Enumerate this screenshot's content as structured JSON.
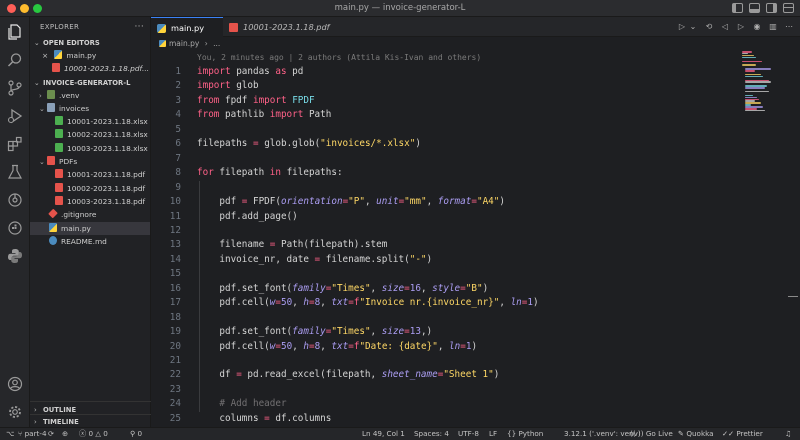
{
  "window": {
    "title": "main.py — invoice-generator-L"
  },
  "colors": {
    "accent": "#3b82f6",
    "python_icon_blue": "#4b8bbe",
    "python_icon_yellow": "#ffd43b",
    "pdf_red": "#e5534b",
    "xlsx_green": "#4caf50",
    "folder": "#d9a35f"
  },
  "activity_bar": [
    "explorer-icon",
    "search-icon",
    "source-control-icon",
    "run-debug-icon",
    "extensions-icon",
    "testing-icon",
    "remote-explorer-icon",
    "docker-icon",
    "python-icon",
    "account-icon",
    "settings-gear-icon"
  ],
  "sidebar": {
    "title": "EXPLORER",
    "more": "···",
    "open_editors": {
      "label": "OPEN EDITORS",
      "items": [
        {
          "close": "×",
          "name": "main.py",
          "icon": "python-file-icon"
        },
        {
          "name": "10001-2023.1.18.pdf...",
          "icon": "pdf-file-icon"
        }
      ]
    },
    "project": {
      "label": "INVOICE-GENERATOR-L",
      "items": [
        {
          "name": ".venv",
          "type": "folder",
          "expanded": false,
          "depth": 0
        },
        {
          "name": "invoices",
          "type": "folder",
          "expanded": true,
          "depth": 0
        },
        {
          "name": "10001-2023.1.18.xlsx",
          "type": "xlsx",
          "depth": 1
        },
        {
          "name": "10002-2023.1.18.xlsx",
          "type": "xlsx",
          "depth": 1
        },
        {
          "name": "10003-2023.1.18.xlsx",
          "type": "xlsx",
          "depth": 1
        },
        {
          "name": "PDFs",
          "type": "folder",
          "expanded": true,
          "depth": 0
        },
        {
          "name": "10001-2023.1.18.pdf",
          "type": "pdf",
          "depth": 1
        },
        {
          "name": "10002-2023.1.18.pdf",
          "type": "pdf",
          "depth": 1
        },
        {
          "name": "10003-2023.1.18.pdf",
          "type": "pdf",
          "depth": 1
        },
        {
          "name": ".gitignore",
          "type": "git",
          "depth": 0
        },
        {
          "name": "main.py",
          "type": "py",
          "depth": 0,
          "selected": true
        },
        {
          "name": "README.md",
          "type": "md",
          "depth": 0
        }
      ]
    },
    "outline": "OUTLINE",
    "timeline": "TIMELINE"
  },
  "tabs": [
    {
      "label": "main.py",
      "active": true
    },
    {
      "label": "10001-2023.1.18.pdf",
      "active": false
    }
  ],
  "breadcrumb": {
    "file": "main.py",
    "separator": "›",
    "more": "..."
  },
  "editor": {
    "blame": "You, 2 minutes ago | 2 authors (Attila Kis-Ivan and others)",
    "lines": [
      {
        "n": "1",
        "code": [
          [
            "kw",
            "import"
          ],
          [
            "t",
            " pandas "
          ],
          [
            "kw",
            "as"
          ],
          [
            "t",
            " pd"
          ]
        ]
      },
      {
        "n": "2",
        "code": [
          [
            "kw",
            "import"
          ],
          [
            "t",
            " glob"
          ]
        ]
      },
      {
        "n": "3",
        "code": [
          [
            "kw",
            "from"
          ],
          [
            "t",
            " fpdf "
          ],
          [
            "kw",
            "import"
          ],
          [
            "t",
            " "
          ],
          [
            "cls",
            "FPDF"
          ]
        ]
      },
      {
        "n": "4",
        "code": [
          [
            "kw",
            "from"
          ],
          [
            "t",
            " pathlib "
          ],
          [
            "kw",
            "import"
          ],
          [
            "t",
            " Path"
          ]
        ]
      },
      {
        "n": "5",
        "code": []
      },
      {
        "n": "6",
        "code": [
          [
            "t",
            "filepaths "
          ],
          [
            "op",
            "="
          ],
          [
            "t",
            " glob.glob("
          ],
          [
            "str",
            "\"invoices/*.xlsx\""
          ],
          [
            "t",
            ")"
          ]
        ]
      },
      {
        "n": "7",
        "code": []
      },
      {
        "n": "8",
        "code": [
          [
            "kw",
            "for"
          ],
          [
            "t",
            " filepath "
          ],
          [
            "kw",
            "in"
          ],
          [
            "t",
            " filepaths:"
          ]
        ]
      },
      {
        "n": "9",
        "code": []
      },
      {
        "n": "10",
        "code": [
          [
            "t",
            "    pdf "
          ],
          [
            "op",
            "="
          ],
          [
            "t",
            " FPDF("
          ],
          [
            "par",
            "orientation"
          ],
          [
            "op",
            "="
          ],
          [
            "str",
            "\"P\""
          ],
          [
            "t",
            ", "
          ],
          [
            "par",
            "unit"
          ],
          [
            "op",
            "="
          ],
          [
            "str",
            "\"mm\""
          ],
          [
            "t",
            ", "
          ],
          [
            "par",
            "format"
          ],
          [
            "op",
            "="
          ],
          [
            "str",
            "\"A4\""
          ],
          [
            "t",
            ")"
          ]
        ]
      },
      {
        "n": "11",
        "code": [
          [
            "t",
            "    pdf.add_page()"
          ]
        ]
      },
      {
        "n": "12",
        "code": []
      },
      {
        "n": "13",
        "code": [
          [
            "t",
            "    filename "
          ],
          [
            "op",
            "="
          ],
          [
            "t",
            " Path(filepath).stem"
          ]
        ]
      },
      {
        "n": "14",
        "code": [
          [
            "t",
            "    invoice_nr, date "
          ],
          [
            "op",
            "="
          ],
          [
            "t",
            " filename.split("
          ],
          [
            "str",
            "\"-\""
          ],
          [
            "t",
            ")"
          ]
        ]
      },
      {
        "n": "15",
        "code": []
      },
      {
        "n": "16",
        "code": [
          [
            "t",
            "    pdf.set_font("
          ],
          [
            "par",
            "family"
          ],
          [
            "op",
            "="
          ],
          [
            "str",
            "\"Times\""
          ],
          [
            "t",
            ", "
          ],
          [
            "par",
            "size"
          ],
          [
            "op",
            "="
          ],
          [
            "num",
            "16"
          ],
          [
            "t",
            ", "
          ],
          [
            "par",
            "style"
          ],
          [
            "op",
            "="
          ],
          [
            "str",
            "\"B\""
          ],
          [
            "t",
            ")"
          ]
        ]
      },
      {
        "n": "17",
        "code": [
          [
            "t",
            "    pdf.cell("
          ],
          [
            "par",
            "w"
          ],
          [
            "op",
            "="
          ],
          [
            "num",
            "50"
          ],
          [
            "t",
            ", "
          ],
          [
            "par",
            "h"
          ],
          [
            "op",
            "="
          ],
          [
            "num",
            "8"
          ],
          [
            "t",
            ", "
          ],
          [
            "par",
            "txt"
          ],
          [
            "op",
            "="
          ],
          [
            "kw",
            "f"
          ],
          [
            "str",
            "\"Invoice nr.{invoice_nr}\""
          ],
          [
            "t",
            ", "
          ],
          [
            "par",
            "ln"
          ],
          [
            "op",
            "="
          ],
          [
            "num",
            "1"
          ],
          [
            "t",
            ")"
          ]
        ]
      },
      {
        "n": "18",
        "code": []
      },
      {
        "n": "19",
        "code": [
          [
            "t",
            "    pdf.set_font("
          ],
          [
            "par",
            "family"
          ],
          [
            "op",
            "="
          ],
          [
            "str",
            "\"Times\""
          ],
          [
            "t",
            ", "
          ],
          [
            "par",
            "size"
          ],
          [
            "op",
            "="
          ],
          [
            "num",
            "13"
          ],
          [
            "t",
            ",)"
          ]
        ]
      },
      {
        "n": "20",
        "code": [
          [
            "t",
            "    pdf.cell("
          ],
          [
            "par",
            "w"
          ],
          [
            "op",
            "="
          ],
          [
            "num",
            "50"
          ],
          [
            "t",
            ", "
          ],
          [
            "par",
            "h"
          ],
          [
            "op",
            "="
          ],
          [
            "num",
            "8"
          ],
          [
            "t",
            ", "
          ],
          [
            "par",
            "txt"
          ],
          [
            "op",
            "="
          ],
          [
            "kw",
            "f"
          ],
          [
            "str",
            "\"Date: {date}\""
          ],
          [
            "t",
            ", "
          ],
          [
            "par",
            "ln"
          ],
          [
            "op",
            "="
          ],
          [
            "num",
            "1"
          ],
          [
            "t",
            ")"
          ]
        ]
      },
      {
        "n": "21",
        "code": []
      },
      {
        "n": "22",
        "code": [
          [
            "t",
            "    df "
          ],
          [
            "op",
            "="
          ],
          [
            "t",
            " pd.read_excel(filepath, "
          ],
          [
            "par",
            "sheet_name"
          ],
          [
            "op",
            "="
          ],
          [
            "str",
            "\"Sheet 1\""
          ],
          [
            "t",
            ")"
          ]
        ]
      },
      {
        "n": "23",
        "code": []
      },
      {
        "n": "24",
        "code": [
          [
            "cmt",
            "    # Add header"
          ]
        ]
      },
      {
        "n": "25",
        "code": [
          [
            "t",
            "    columns "
          ],
          [
            "op",
            "="
          ],
          [
            "t",
            " df.columns"
          ]
        ]
      }
    ]
  },
  "statusbar": {
    "branch": "part-4",
    "errors": "0",
    "warnings": "0",
    "position": "Ln 49, Col 1",
    "spaces": "Spaces: 4",
    "encoding": "UTF-8",
    "eol": "LF",
    "language": "Python",
    "interpreter": "3.12.1 ('.venv': venv)",
    "go_live": "Go Live",
    "quokka": "Quokka",
    "prettier": "Prettier"
  }
}
